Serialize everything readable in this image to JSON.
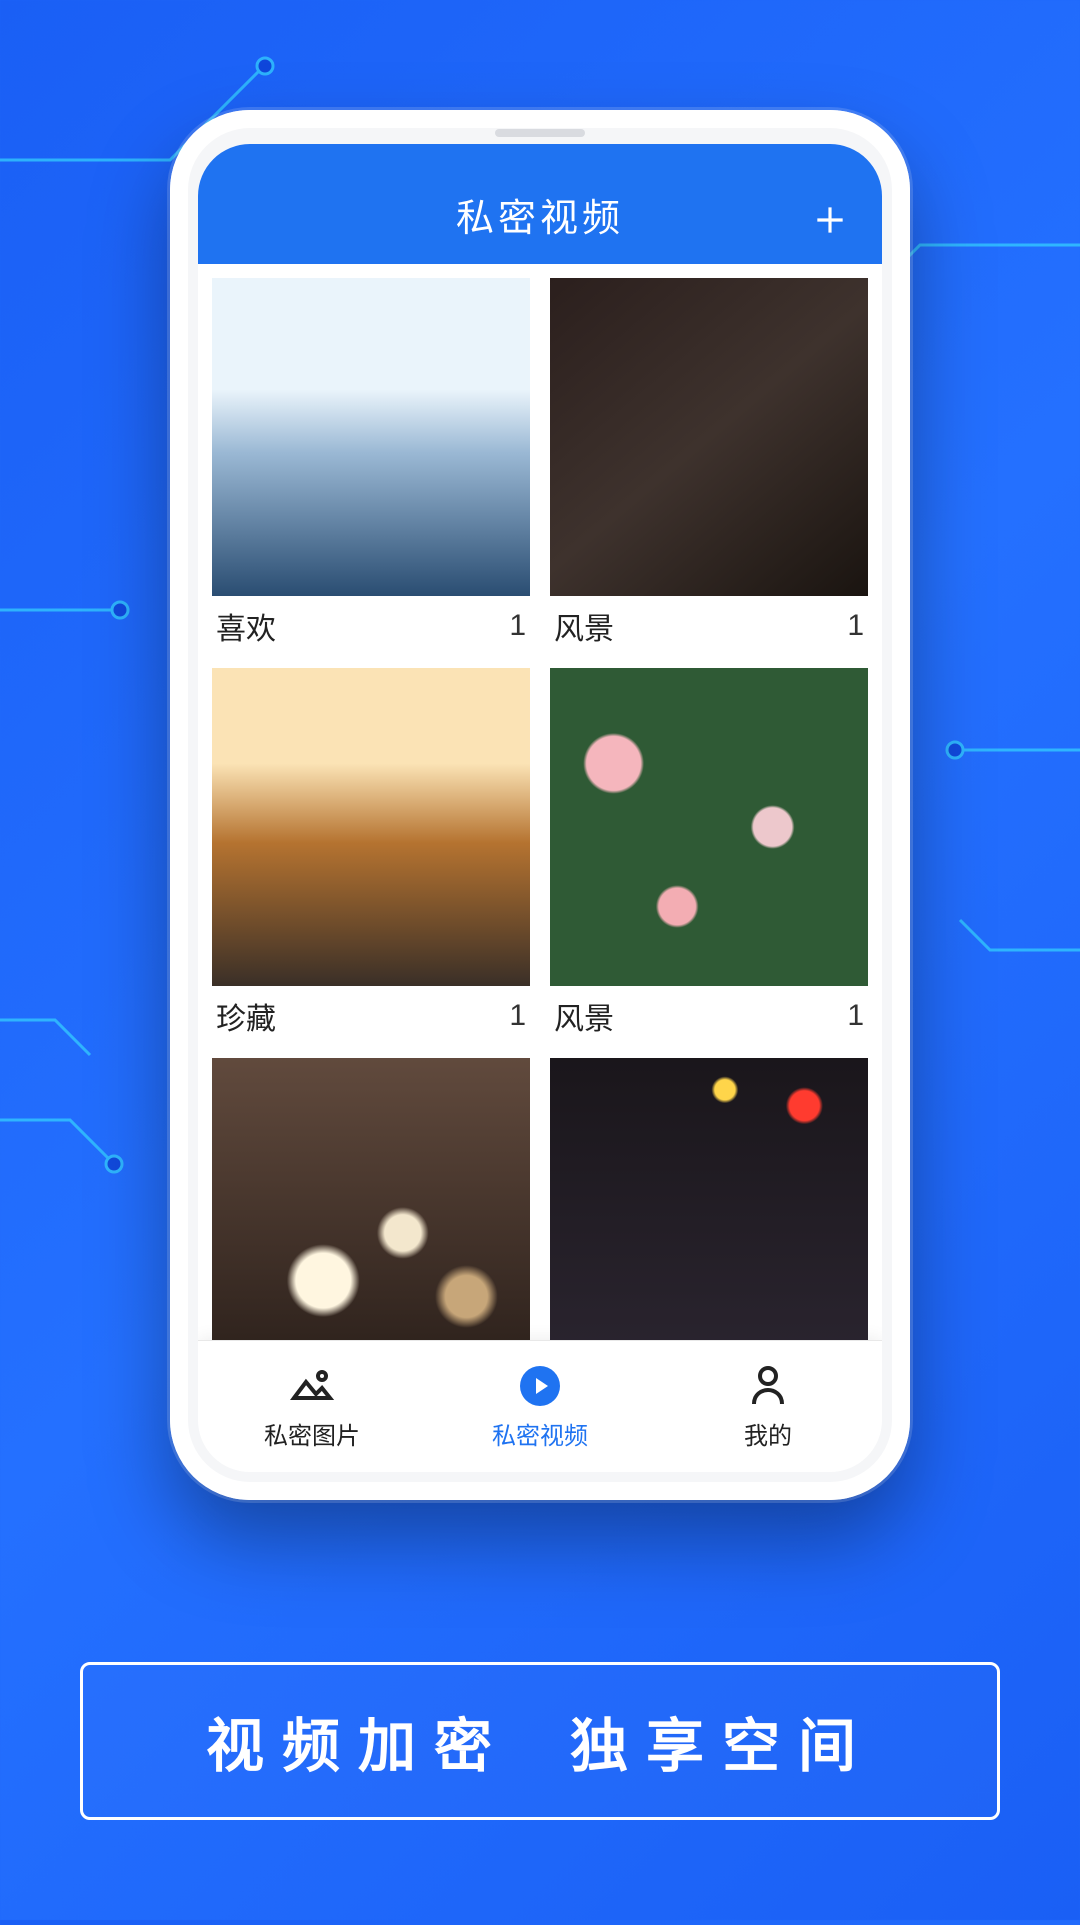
{
  "header": {
    "title": "私密视频"
  },
  "albums": [
    {
      "name": "喜欢",
      "count": 1
    },
    {
      "name": "风景",
      "count": 1
    },
    {
      "name": "珍藏",
      "count": 1
    },
    {
      "name": "风景",
      "count": 1
    },
    {
      "name": "",
      "count": ""
    },
    {
      "name": "",
      "count": ""
    }
  ],
  "nav": {
    "images": "私密图片",
    "videos": "私密视频",
    "mine": "我的"
  },
  "promo": {
    "left": "视频加密",
    "right": "独享空间"
  }
}
